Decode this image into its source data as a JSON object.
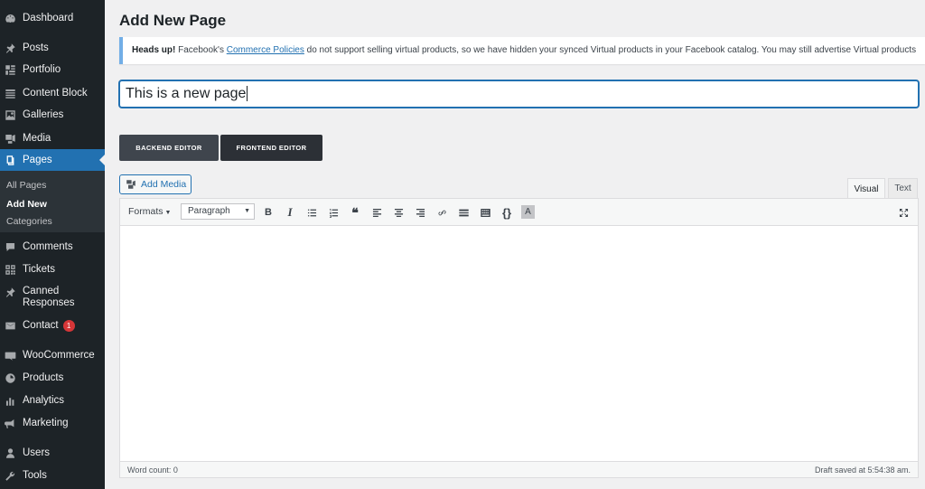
{
  "sidebar": {
    "items": [
      {
        "label": "Dashboard",
        "icon": "dashboard-icon"
      },
      {
        "label": "Posts",
        "icon": "pin-icon"
      },
      {
        "label": "Portfolio",
        "icon": "grid-icon"
      },
      {
        "label": "Content Block",
        "icon": "block-icon"
      },
      {
        "label": "Galleries",
        "icon": "gallery-icon"
      },
      {
        "label": "Media",
        "icon": "media-icon"
      },
      {
        "label": "Pages",
        "icon": "pages-icon",
        "active": true
      },
      {
        "label": "Comments",
        "icon": "comment-icon"
      },
      {
        "label": "Tickets",
        "icon": "ticket-icon"
      },
      {
        "label": "Canned Responses",
        "icon": "pin-icon"
      },
      {
        "label": "Contact",
        "icon": "mail-icon",
        "badge": "1"
      },
      {
        "label": "WooCommerce",
        "icon": "woo-icon"
      },
      {
        "label": "Products",
        "icon": "products-icon"
      },
      {
        "label": "Analytics",
        "icon": "analytics-icon"
      },
      {
        "label": "Marketing",
        "icon": "megaphone-icon"
      },
      {
        "label": "Users",
        "icon": "user-icon"
      },
      {
        "label": "Tools",
        "icon": "wrench-icon"
      }
    ],
    "canned_line1": "Canned",
    "canned_line2": "Responses",
    "submenu": [
      "All Pages",
      "Add New",
      "Categories"
    ]
  },
  "page": {
    "title": "Add New Page",
    "notice": {
      "strong": "Heads up!",
      "before_link": " Facebook's ",
      "link": "Commerce Policies",
      "after_link": " do not support selling virtual products, so we have hidden your synced Virtual products in your Facebook catalog. You may still advertise Virtual products"
    },
    "post_title_value": "This is a new page",
    "backend_editor": "BACKEND EDITOR",
    "frontend_editor": "FRONTEND EDITOR",
    "add_media": "Add Media",
    "tabs": {
      "visual": "Visual",
      "text": "Text"
    },
    "toolbar": {
      "formats": "Formats",
      "paragraph": "Paragraph"
    },
    "word_count": "Word count: 0",
    "draft_saved": "Draft saved at 5:54:38 am."
  },
  "colors": {
    "sidebar_bg": "#1d2327",
    "accent": "#2271b1",
    "badge": "#d63638"
  }
}
